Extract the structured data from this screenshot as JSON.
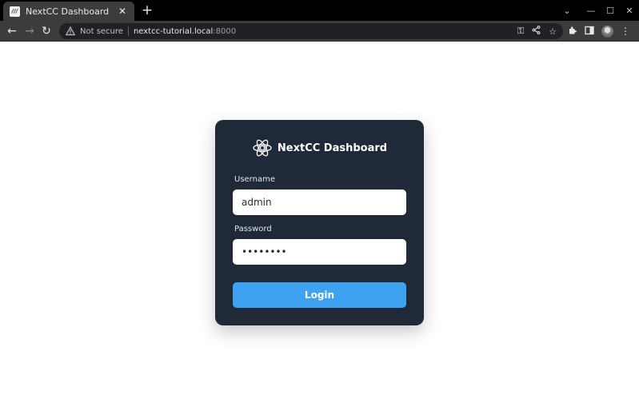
{
  "browser": {
    "tab": {
      "title": "NextCC Dashboard",
      "favicon": "nextcc-favicon",
      "favicon_text": "///"
    },
    "security_label": "Not secure",
    "url_host": "nextcc-tutorial.local",
    "url_port": ":8000",
    "icons": [
      "back-icon",
      "forward-icon",
      "reload-icon",
      "key-icon",
      "share-icon",
      "star-icon",
      "extensions-icon",
      "side-panel-icon",
      "profile-icon",
      "menu-icon"
    ]
  },
  "login": {
    "title": "NextCC Dashboard",
    "username_label": "Username",
    "username_value": "admin",
    "password_label": "Password",
    "password_value": "••••••••",
    "submit_label": "Login"
  },
  "colors": {
    "card_bg": "#1f2937",
    "button_bg": "#3ea2f0",
    "page_bg": "#ffffff"
  }
}
